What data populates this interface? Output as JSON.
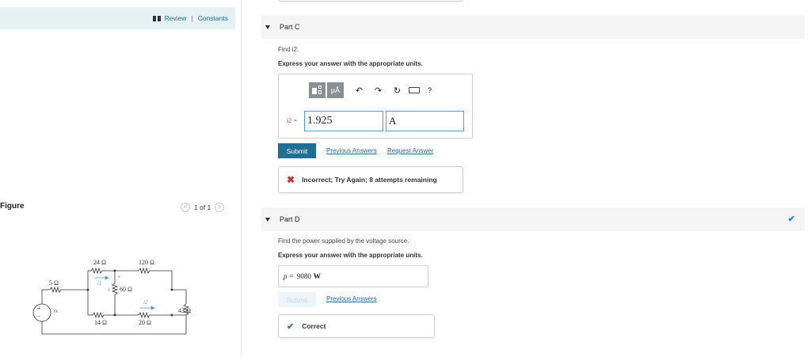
{
  "header": {
    "review": "Review",
    "separator": "|",
    "constants": "Constants"
  },
  "figure": {
    "label": "Figure",
    "pager_text": "1 of 1",
    "prev": "<",
    "next": ">",
    "circuit": {
      "source_label": "Vs",
      "source_plus": "+",
      "source_minus": "−",
      "r5": "5 Ω",
      "r24": "24 Ω",
      "r120": "120 Ω",
      "r60": "60 Ω",
      "r14": "14 Ω",
      "r20": "20 Ω",
      "r43": "43 Ω",
      "i1": "i1",
      "i2": "i2",
      "v": "v",
      "plus": "+"
    }
  },
  "partC": {
    "title": "Part C",
    "prompt": "Find i2.",
    "instruction": "Express your answer with the appropriate units.",
    "toolbar": {
      "units_btn": "μÅ",
      "undo": "↶",
      "redo": "↷",
      "reset": "↻",
      "help": "?"
    },
    "var_label": "i2 =",
    "value": "1.925",
    "unit": "A",
    "submit": "Submit",
    "previous_answers": "Previous Answers",
    "request_answer": "Request Answer",
    "feedback": "Incorrect; Try Again; 8 attempts remaining"
  },
  "partD": {
    "title": "Part D",
    "prompt": "Find the power supplied by the voltage source.",
    "instruction": "Express your answer with the appropriate units.",
    "var_label": "p =",
    "value": "9080",
    "unit": "W",
    "submit": "Submit",
    "previous_answers": "Previous Answers",
    "feedback": "Correct"
  },
  "colors": {
    "accent": "#1f6f96",
    "link": "#1a6e9c",
    "incorrect": "#d0312d",
    "correct": "#2e8b3d",
    "complete_check": "#1f8dc8"
  }
}
